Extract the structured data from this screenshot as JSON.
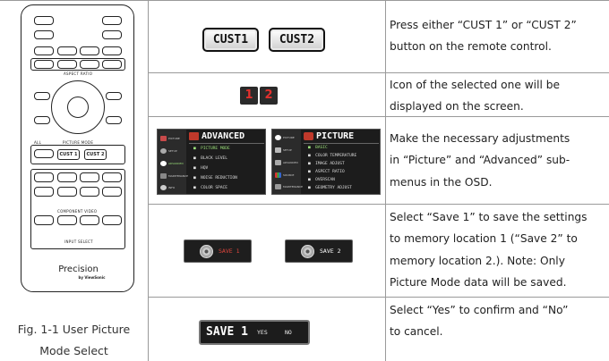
{
  "remote": {
    "labels": {
      "aspect_ratio": "ASPECT RATIO",
      "all": "ALL",
      "picture_mode": "PICTURE MODE",
      "cust1": "CUST 1",
      "cust2": "CUST 2",
      "component_video": "COMPONENT VIDEO",
      "input_select": "INPUT SELECT",
      "brand": "Precision",
      "brand_sub": "by ViewSonic"
    }
  },
  "figure_caption": {
    "line1": "Fig. 1-1 User Picture",
    "line2": "Mode Select"
  },
  "rows": [
    {
      "cust1_label": "CUST1",
      "cust2_label": "CUST2",
      "text": [
        "Press either “CUST 1” or “CUST 2”",
        "button on the remote control."
      ]
    },
    {
      "num1": "1",
      "num2": "2",
      "text": [
        "Icon of the selected one will be",
        "displayed on the screen."
      ]
    },
    {
      "advanced_title": "ADVANCED",
      "advanced_items": [
        "PICTURE MODE",
        "BLACK LEVEL",
        "HQV",
        "NOISE REDUCTION",
        "COLOR SPACE"
      ],
      "advanced_side": [
        "PICTURE",
        "SETUP",
        "ADVANCED",
        "MAINTENANCE",
        "INFO"
      ],
      "picture_title": "PICTURE",
      "picture_items": [
        "BASIC",
        "COLOR TEMPERATURE",
        "IMAGE ADJUST",
        "ASPECT RATIO",
        "OVERSCAN",
        "GEOMETRY ADJUST"
      ],
      "picture_side": [
        "PICTURE",
        "SETUP",
        "ADVANCED",
        "SOURCE",
        "MAINTENANCE"
      ],
      "text": [
        "Make the necessary adjustments",
        "in “Picture” and “Advanced” sub-",
        "menus in the OSD."
      ]
    },
    {
      "save1_label": "SAVE 1",
      "save2_label": "SAVE 2",
      "text": [
        "Select “Save 1” to save the settings",
        "to memory location 1 (“Save 2” to",
        "memory location 2.). Note: Only",
        "Picture Mode data will be saved."
      ]
    },
    {
      "confirm_title": "SAVE 1",
      "yes_label": "YES",
      "no_label": "NO",
      "text": [
        "Select “Yes” to confirm and “No”",
        "to cancel."
      ]
    }
  ]
}
